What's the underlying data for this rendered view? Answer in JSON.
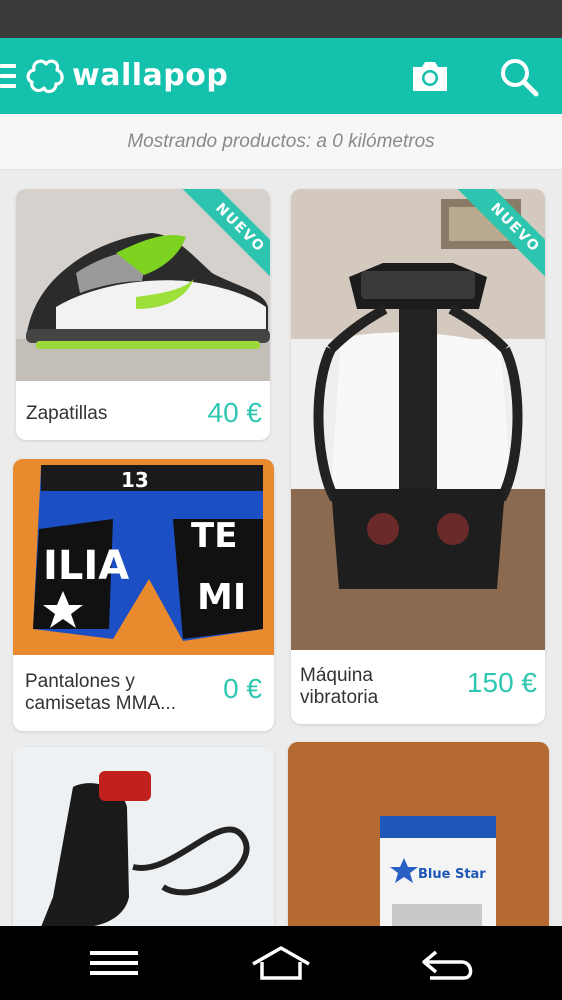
{
  "app": {
    "title": "wallapop"
  },
  "icons": {
    "menu": "menu-icon",
    "logo": "wallapop-logo-icon",
    "camera": "camera-icon",
    "search": "search-icon",
    "nav_menu": "menu-icon",
    "nav_home": "home-icon",
    "nav_back": "back-icon"
  },
  "colors": {
    "accent": "#13c1ac",
    "price": "#2fc7b1",
    "ribbon": "#2ec5b0"
  },
  "subheader": {
    "text": "Mostrando productos: a 0 kilómetros"
  },
  "products": [
    {
      "title": "Zapatillas",
      "price": "40 €",
      "badge": "NUEVO"
    },
    {
      "title": "Máquina vibratoria",
      "price": "150 €",
      "badge": "NUEVO"
    },
    {
      "title": "Pantalones y camisetas MMA...",
      "price": "0 €"
    },
    {
      "title": "",
      "price": ""
    },
    {
      "title": "",
      "price": ""
    }
  ]
}
